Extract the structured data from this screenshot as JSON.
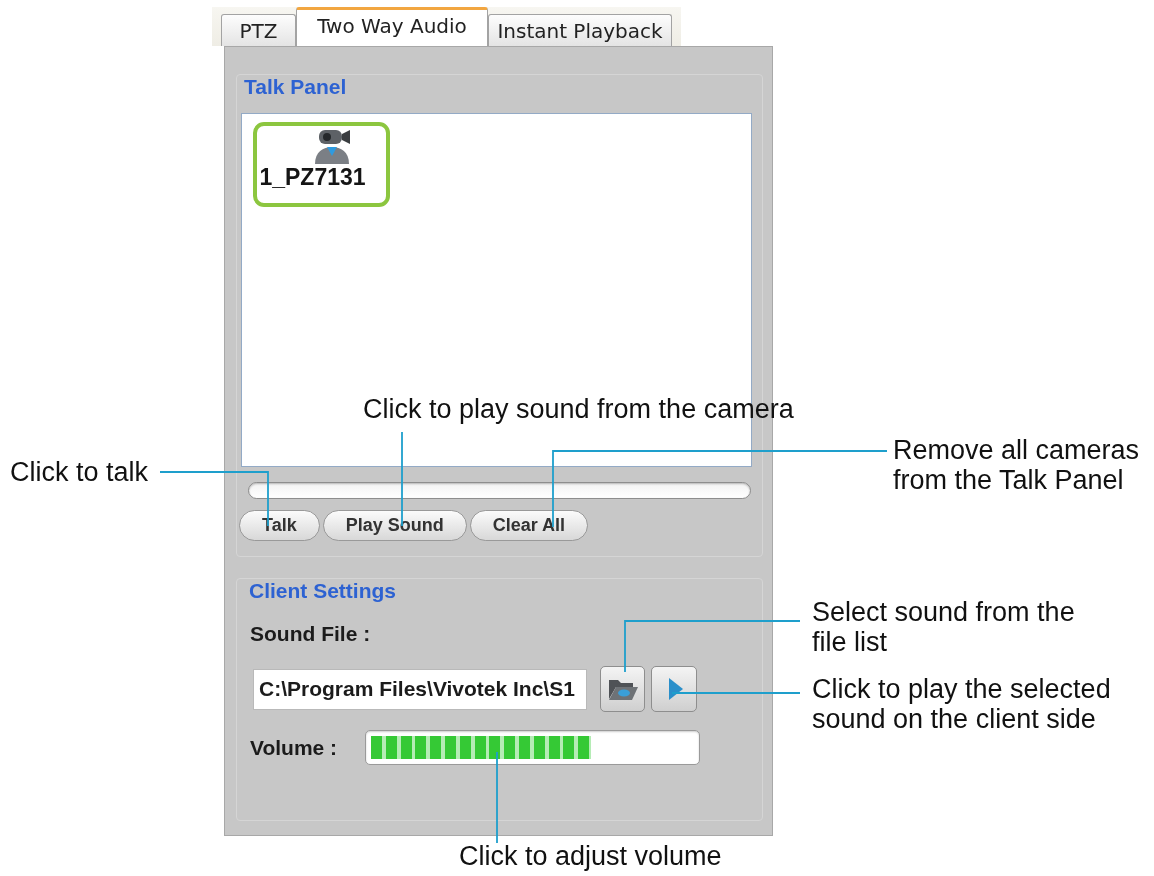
{
  "tabs": [
    {
      "label": "PTZ",
      "selected": false
    },
    {
      "label": "Two Way Audio",
      "selected": true
    },
    {
      "label": "Instant Playback",
      "selected": false
    }
  ],
  "talk_panel": {
    "title": "Talk Panel",
    "cameras": [
      {
        "name": "1_PZ7131",
        "selected": true
      }
    ],
    "buttons": [
      "Talk",
      "Play Sound",
      "Clear All"
    ]
  },
  "client_settings": {
    "title": "Client Settings",
    "sound_file": {
      "label": "Sound File :",
      "value": "C:\\Program Files\\Vivotek Inc\\S1"
    },
    "volume": {
      "label": "Volume :",
      "level": 0.68
    }
  },
  "callouts": [
    "Click to play sound from the camera",
    "Click to talk",
    "Remove all cameras from the Talk Panel",
    "Select sound from the file list",
    "Click to play the selected sound on the client side",
    "Click to adjust volume"
  ]
}
